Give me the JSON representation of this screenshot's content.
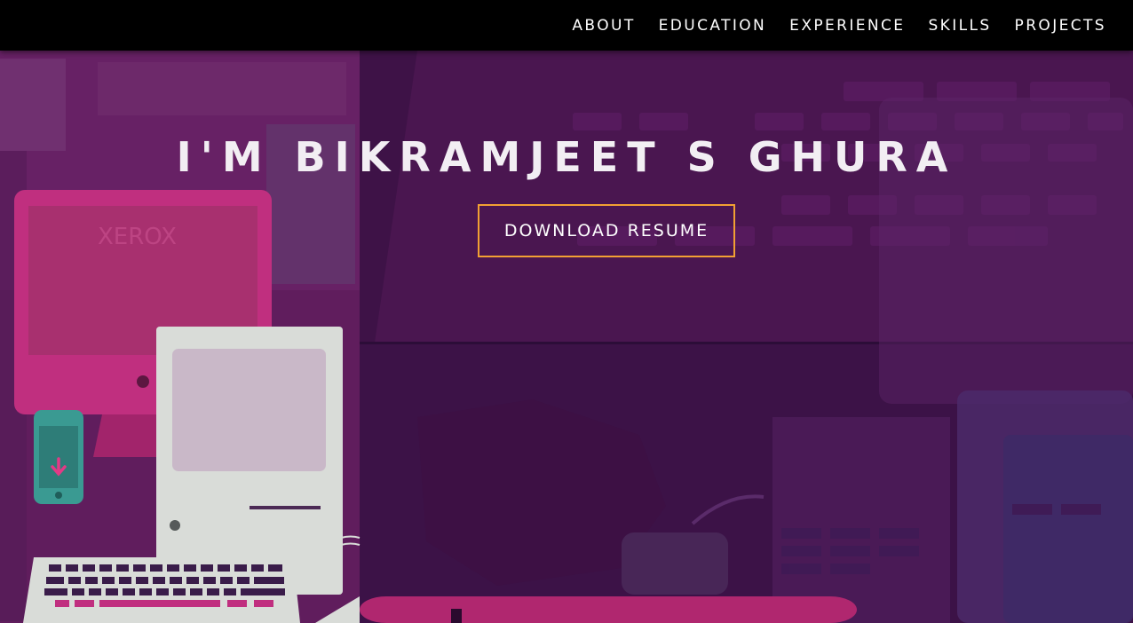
{
  "nav": {
    "items": [
      {
        "label": "ABOUT"
      },
      {
        "label": "EDUCATION"
      },
      {
        "label": "EXPERIENCE"
      },
      {
        "label": "SKILLS"
      },
      {
        "label": "PROJECTS"
      }
    ]
  },
  "hero": {
    "title": "I'M BIKRAMJEET S GHURA",
    "resume_button": "DOWNLOAD RESUME"
  },
  "art": {
    "monitor_brand": "XEROX"
  },
  "colors": {
    "nav_bg": "#000000",
    "hero_bg": "#3a1244",
    "accent_pink": "#c02f7f",
    "button_border": "#f2a033",
    "phone_teal": "#3a9a92",
    "mac_beige": "#d9dcd8"
  }
}
